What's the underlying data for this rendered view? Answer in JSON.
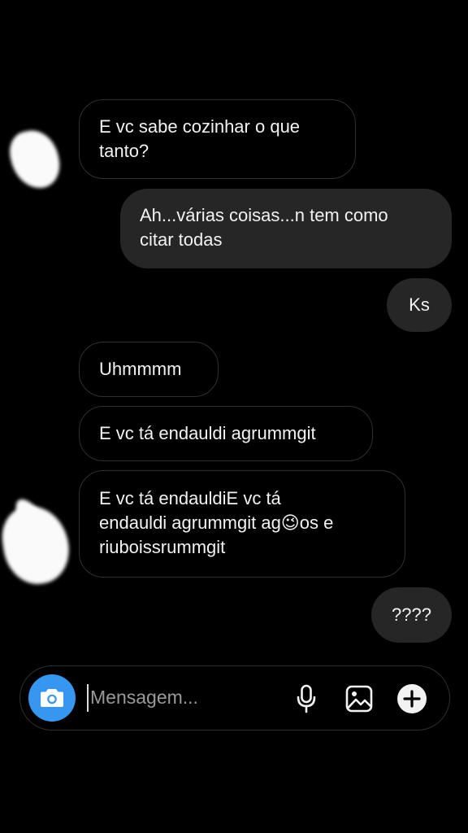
{
  "messages": [
    {
      "side": "received",
      "lines": [
        "E vc sabe cozinhar o que",
        "tanto?"
      ]
    },
    {
      "side": "sent",
      "lines": [
        "Ah...várias coisas...n tem como",
        "citar todas"
      ]
    },
    {
      "side": "sent",
      "lines": [
        "Ks"
      ]
    },
    {
      "side": "received",
      "lines": [
        "Uhmmmm"
      ]
    },
    {
      "side": "received",
      "lines": [
        "E vc tá endauldi agrummgit"
      ]
    },
    {
      "side": "received",
      "lines": [
        "E vc tá endauldiE vc tá",
        "endauldi agrummgit ag😉os e",
        "riuboissrummgit"
      ]
    },
    {
      "side": "sent",
      "lines": [
        "????"
      ]
    }
  ],
  "composer": {
    "placeholder": "Mensagem...",
    "icons": [
      "camera-icon",
      "microphone-icon",
      "gallery-icon",
      "plus-icon"
    ]
  },
  "colors": {
    "background": "#000000",
    "sent_bubble": "#262626",
    "received_border": "#2f2f2f",
    "camera_button": "#3797f0",
    "text": "#f2f2f2"
  }
}
